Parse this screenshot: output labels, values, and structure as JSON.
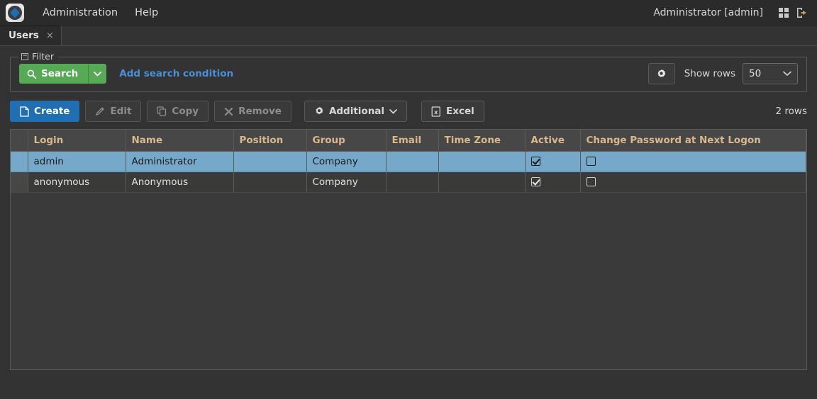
{
  "topbar": {
    "logo_name": "app-logo",
    "nav": [
      {
        "label": "Administration"
      },
      {
        "label": "Help"
      }
    ],
    "user": "Administrator [admin]",
    "icons": [
      {
        "name": "grid-apps-icon"
      },
      {
        "name": "logout-icon"
      }
    ]
  },
  "tabs": [
    {
      "label": "Users",
      "close": "×"
    }
  ],
  "filter": {
    "legend": "Filter",
    "collapse_glyph": "−",
    "search_label": "Search",
    "search_icon": "search-icon",
    "search_caret": "⌄",
    "add_condition_label": "Add search condition",
    "settings_icon": "gear-icon",
    "show_rows_label": "Show rows",
    "rows_value": "50",
    "rows_options": [
      "50"
    ],
    "rows_caret": "⌄"
  },
  "toolbar": {
    "create_label": "Create",
    "edit_label": "Edit",
    "copy_label": "Copy",
    "remove_label": "Remove",
    "additional_label": "Additional",
    "additional_caret": "⌄",
    "excel_label": "Excel",
    "row_count": "2 rows"
  },
  "table": {
    "columns": [
      "Login",
      "Name",
      "Position",
      "Group",
      "Email",
      "Time Zone",
      "Active",
      "Change Password at Next Logon"
    ],
    "rows": [
      {
        "selected": true,
        "login": "admin",
        "name": "Administrator",
        "position": "",
        "group": "Company",
        "email": "",
        "time_zone": "",
        "active": true,
        "change_password": false
      },
      {
        "selected": false,
        "login": "anonymous",
        "name": "Anonymous",
        "position": "",
        "group": "Company",
        "email": "",
        "time_zone": "",
        "active": true,
        "change_password": false
      }
    ]
  },
  "colors": {
    "page_bg": "#333333",
    "topbar_bg": "#2b2b2b",
    "accent_blue": "#1f6fb2",
    "link_blue": "#4a90d9",
    "search_green": "#56aa56",
    "selection_blue": "#76a8c9",
    "header_text": "#d9b98b"
  }
}
